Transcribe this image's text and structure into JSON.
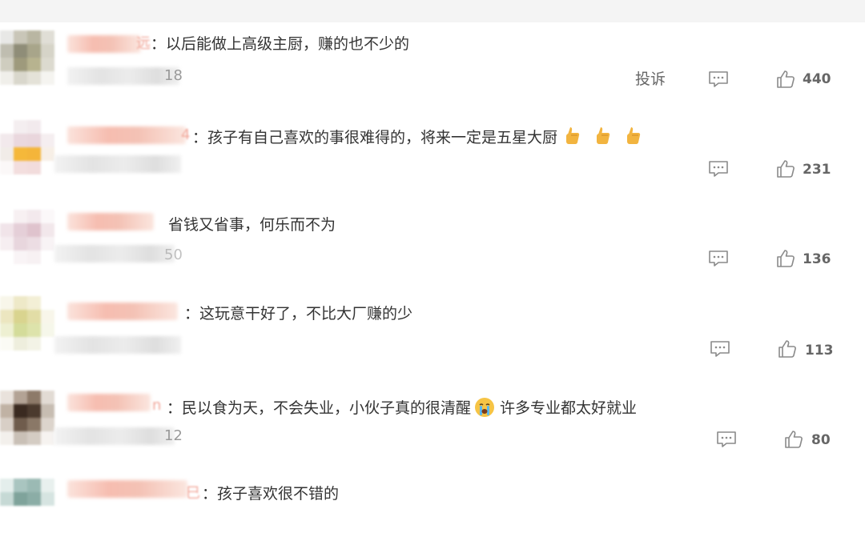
{
  "comments": [
    {
      "name_tail": "远",
      "meta_tail": "18",
      "text": "：以后能做上高级主厨，赚的也不少的",
      "report_label": "投诉",
      "likes": "440"
    },
    {
      "name_tail": "4",
      "meta_tail": "",
      "text": "：孩子有自己喜欢的事很难得的，将来一定是五星大厨",
      "emojis": [
        "thumbs-up-emoji",
        "thumbs-up-emoji",
        "thumbs-up-emoji"
      ],
      "likes": "231"
    },
    {
      "name_tail": "",
      "meta_tail": "50",
      "text": "省钱又省事，何乐而不为",
      "likes": "136"
    },
    {
      "name_tail": "",
      "meta_tail": "",
      "text": "：这玩意干好了，不比大厂赚的少",
      "likes": "113"
    },
    {
      "name_tail": "n",
      "meta_tail": "12",
      "text_a": "：民以食为天，不会失业，小伙子真的很清醒",
      "text_b": "许多专业都太好就业",
      "emoji": "crying-face-emoji",
      "likes": "80"
    },
    {
      "name_tail": "巳",
      "meta_tail": "",
      "text": "：孩子喜欢很不错的"
    }
  ],
  "icons": {
    "reply": "comment-icon",
    "like": "thumbs-up-icon"
  },
  "colors": {
    "text": "#333333",
    "muted": "#666666",
    "icon": "#8a8a8a"
  }
}
